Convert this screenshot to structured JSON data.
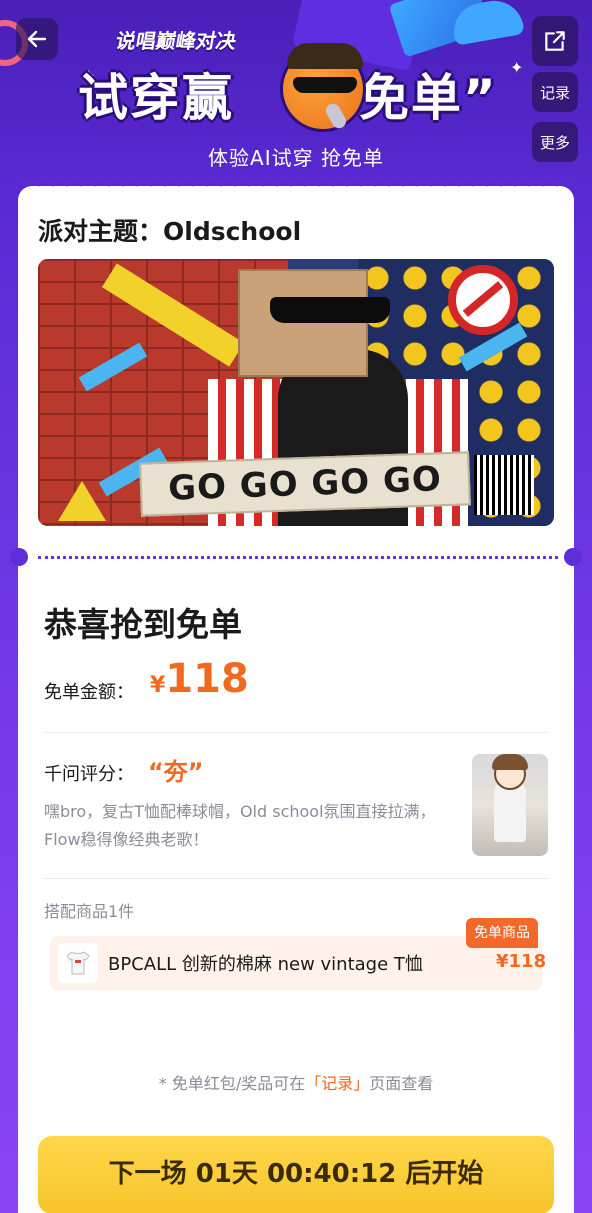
{
  "header": {
    "subtitle": "说唱巅峰对决",
    "title_left": "试穿赢",
    "title_right": "“免单”",
    "tagline": "体验AI试穿 抢免单",
    "share_icon": "share-icon",
    "record_label": "记录",
    "more_label": "更多",
    "back_icon": "back-arrow-icon"
  },
  "theme": {
    "label": "派对主题：Oldschool",
    "banner_text": "GO GO GO GO"
  },
  "result": {
    "congrats": "恭喜抢到免单",
    "amount_label": "免单金额：",
    "currency": "¥",
    "amount": "118"
  },
  "rating": {
    "label": "千问评分：",
    "value": "“夯”",
    "comment": "嘿bro，复古T恤配棒球帽，Old school氛围直接拉满，Flow稳得像经典老歌！"
  },
  "products": {
    "label": "搭配商品1件",
    "badge": "免单商品",
    "name": "BPCALL 创新的棉麻 new vintage T恤",
    "price": "¥118"
  },
  "note": {
    "prefix": "* 免单红包/奖品可在",
    "highlight": "「记录」",
    "suffix": "页面查看"
  },
  "cta": {
    "label": "下一场 01天 00:40:12 后开始"
  },
  "colors": {
    "accent": "#ef6a1e",
    "purple": "#6a33e0",
    "cta": "#f7c52c"
  }
}
